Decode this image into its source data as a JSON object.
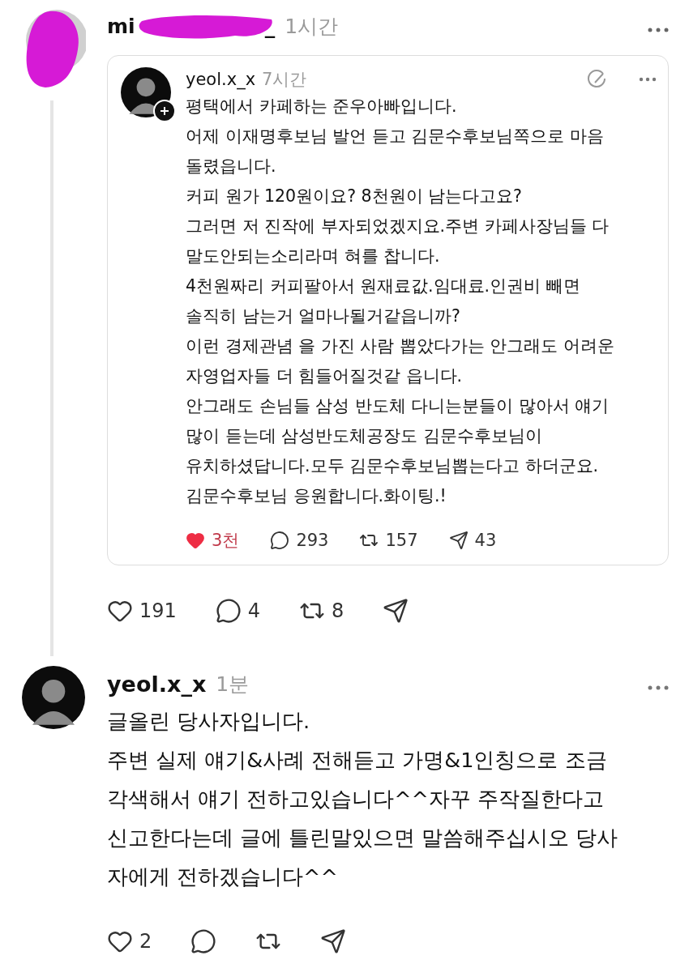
{
  "post": {
    "username_start": "mi",
    "username_end": "_",
    "time": "1시간",
    "redacted": true,
    "quote": {
      "username": "yeol.x_x",
      "time": "7시간",
      "lines": [
        "평택에서 카페하는 준우아빠입니다.",
        "어제 이재명후보님 발언 듣고 김문수후보님쪽으로 마음",
        "돌렸읍니다.",
        "커피 원가 120원이요? 8천원이 남는다고요?",
        "그러면 저 진작에 부자되었겠지요.주변 카페사장님들 다",
        "말도안되는소리라며 혀를 찹니다.",
        "4천원짜리 커피팔아서 원재료값.임대료.인권비 빼면",
        "솔직히 남는거 얼마나될거같읍니까?",
        "이런 경제관념 을 가진 사람 뽑았다가는 안그래도 어려운",
        "자영업자들 더 힘들어질것같 읍니다.",
        "안그래도 손님들 삼성 반도체 다니는분들이 많아서 얘기",
        "많이 듣는데 삼성반도체공장도 김문수후보님이",
        "유치하셨답니다.모두 김문수후보님뽑는다고 하더군요.",
        "김문수후보님 응원합니다.화이팅.!"
      ],
      "liked": true,
      "likes": "3천",
      "replies": "293",
      "reposts": "157",
      "shares": "43"
    },
    "liked": false,
    "likes": "191",
    "replies": "4",
    "reposts": "8"
  },
  "reply": {
    "username": "yeol.x_x",
    "time": "1분",
    "lines": [
      "글올린 당사자입니다.",
      "주변 실제 얘기&사례 전해듣고 가명&1인칭으로 조금",
      "각색해서 얘기 전하고있습니다^^자꾸 주작질한다고",
      "신고한다는데 글에 틀린말있으면 말씀해주십시오 당사",
      "자에게 전하겠습니다^^"
    ],
    "liked": false,
    "likes": "2"
  }
}
